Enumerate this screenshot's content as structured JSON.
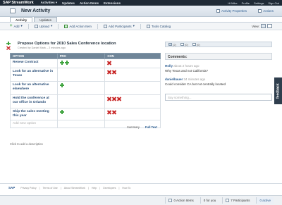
{
  "topnav": {
    "logo": "SAP StreamWork",
    "items": [
      "Activities ▾",
      "Updates",
      "Action Items",
      "Extensions"
    ],
    "right": [
      "Hi Mike",
      "Profile",
      "Settings",
      "Sign Out"
    ]
  },
  "titlebar": {
    "title": "New Activity",
    "activity_properties": "Activity Properties",
    "actions": "Actions"
  },
  "tabs": [
    "Activity",
    "Updates"
  ],
  "toolbar": {
    "add": "Add",
    "upload": "Upload",
    "add_action_item": "Add Action Item",
    "add_participants": "Add Participants",
    "tools_catalog": "Tools Catalog",
    "view_label": "View:"
  },
  "decision": {
    "title": "Propose Options for 2010 Sales Conference location",
    "subtitle": "Created by Daniel Mark – 2 minutes ago",
    "columns": [
      "OPTION",
      "PRO",
      "CON"
    ],
    "rows": [
      {
        "option": "Renew Contract",
        "pro": 2,
        "con": 1
      },
      {
        "option": "Look for an alternative in Texas",
        "pro": 0,
        "con": 2
      },
      {
        "option": "Look for an alternative elsewhere",
        "pro": 1,
        "con": 0
      },
      {
        "option": "Hold the conference at our office in Orlando",
        "pro": 0,
        "con": 3
      },
      {
        "option": "Skip the sales meeting this year",
        "pro": 1,
        "con": 2
      }
    ],
    "add_option": "Add new option",
    "summary_link": "Summary",
    "full_text_link": "Full Text"
  },
  "description_hint": "Click to add a description",
  "right_panel": {
    "toolbar": [
      "(2)",
      "(0)",
      "(0)"
    ],
    "comments_title": "Comments:",
    "comments": [
      {
        "author": "Holly",
        "time": "about 2 hours ago",
        "text": "Why Texas and not California?"
      },
      {
        "author": "danielbauer",
        "time": "34 minutes ago",
        "text": "Could consider CA but not centrally located"
      }
    ],
    "comment_placeholder": "Say something..."
  },
  "feedback_label": "feedback",
  "footer": {
    "logo": "SAP",
    "links": [
      "Privacy Policy",
      "Terms of Use",
      "About StreamWork",
      "Help",
      "Developers",
      "How To"
    ]
  },
  "statusbar": {
    "action_items": "0 Action Items",
    "for_you": "0 for you",
    "participants": "7 Participants",
    "active": "0 active"
  }
}
